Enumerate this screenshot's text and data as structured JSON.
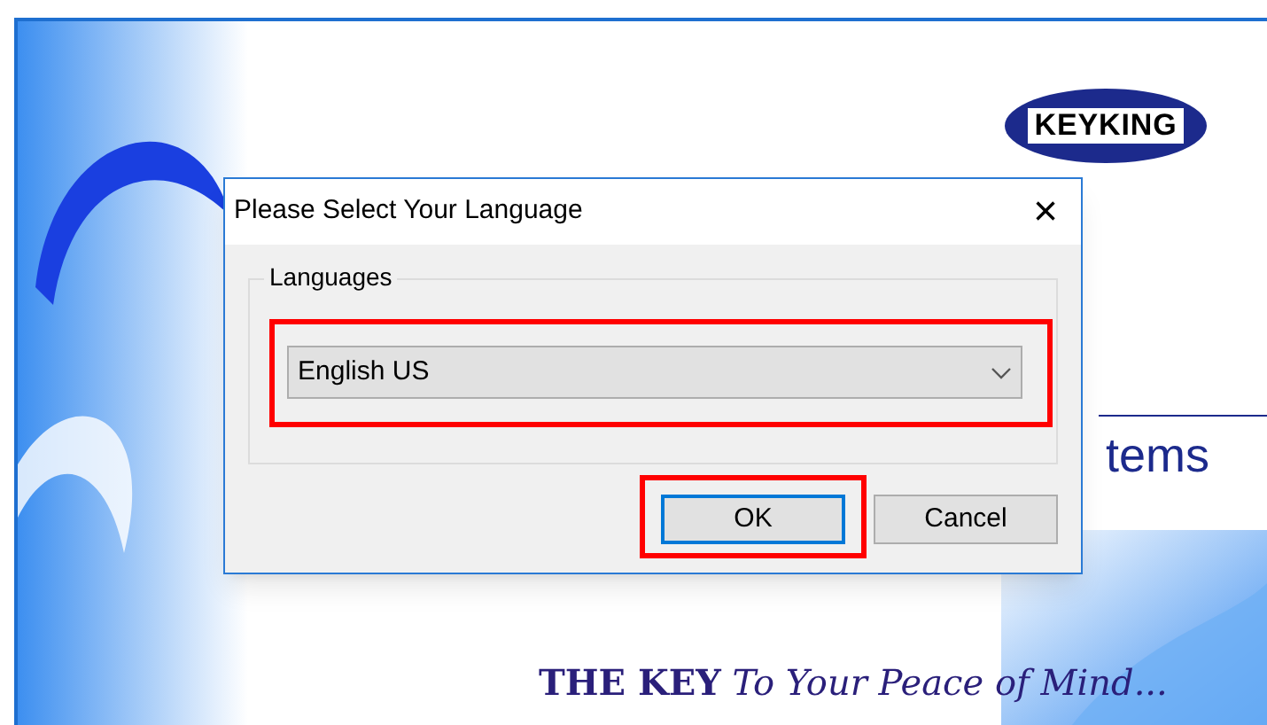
{
  "splash": {
    "logo": "KEYKING",
    "heading": "tems",
    "slogan": "**THE KEY** *To Your Peace of Mind...*"
  },
  "dialog": {
    "title": "Please Select Your Language",
    "close": "×",
    "group_label": "Languages",
    "language_select": {
      "value": "English US",
      "highlighted": true
    },
    "buttons": [
      {
        "label": "OK",
        "default": true,
        "highlighted": true
      },
      {
        "label": "Cancel",
        "default": false,
        "highlighted": false
      }
    ]
  }
}
